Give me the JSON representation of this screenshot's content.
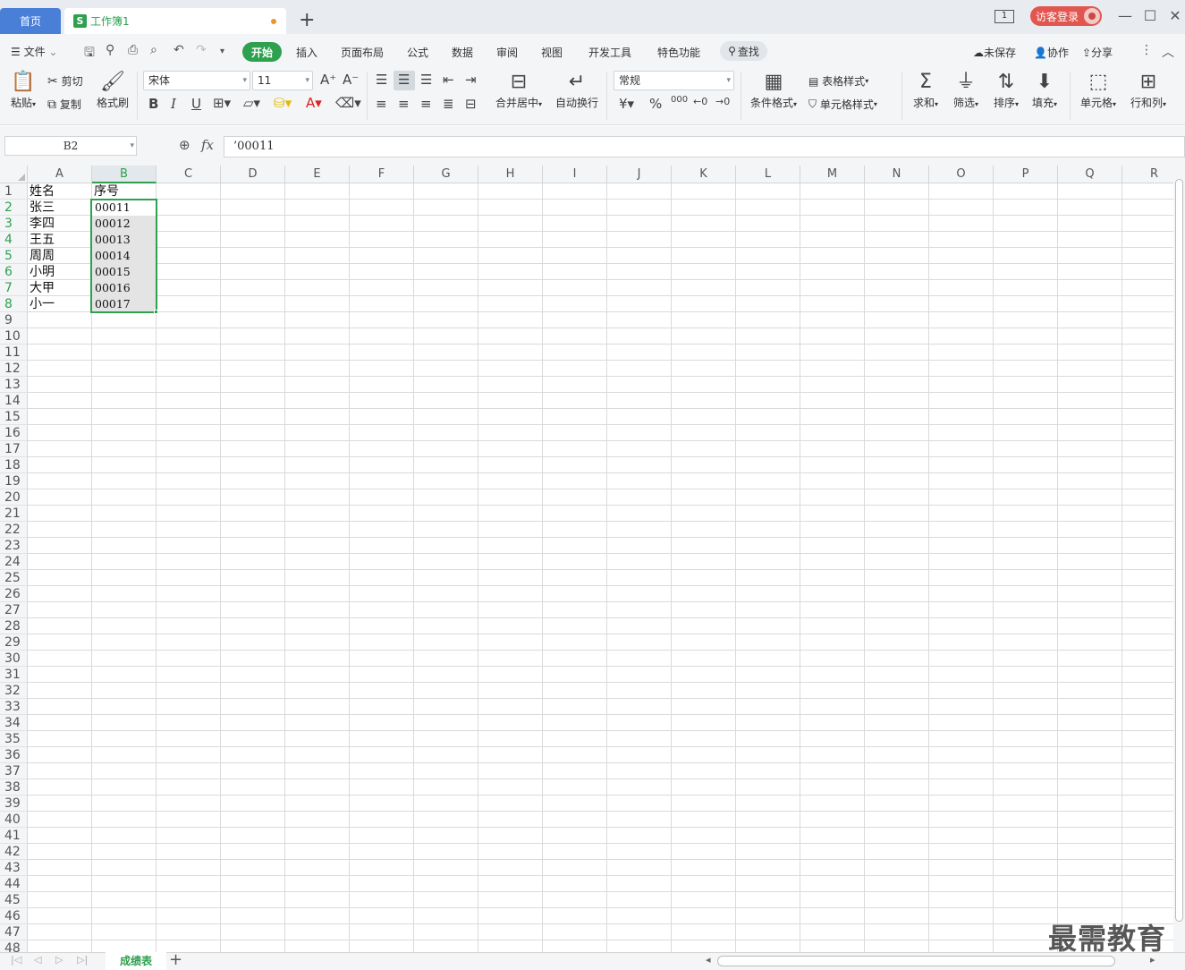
{
  "titlebar": {
    "home_tab": "首页",
    "doc_tab": "工作簿1",
    "doc_logo": "S",
    "page_badge": "1",
    "login": "访客登录",
    "add": "+",
    "minimize": "—",
    "maximize": "☐",
    "close": "✕"
  },
  "menu": {
    "file": "文件",
    "start": "开始",
    "insert": "插入",
    "layout": "页面布局",
    "formula": "公式",
    "data": "数据",
    "review": "审阅",
    "view": "视图",
    "dev": "开发工具",
    "special": "特色功能",
    "search": "查找",
    "unsaved": "未保存",
    "collab": "协作",
    "share": "分享"
  },
  "ribbon": {
    "paste": "粘贴",
    "cut": "剪切",
    "copy": "复制",
    "format_painter": "格式刷",
    "font_name": "宋体",
    "font_size": "11",
    "merge": "合并居中",
    "wrap": "自动换行",
    "number_format": "常规",
    "cond_format": "条件格式",
    "table_style": "表格样式",
    "cell_style": "单元格样式",
    "sum": "求和",
    "filter": "筛选",
    "sort": "排序",
    "fill": "填充",
    "cell": "单元格",
    "rowcol": "行和列",
    "bold": "B",
    "italic": "I",
    "underline": "U",
    "currency": "¥",
    "percent": "%",
    "thousands": "000"
  },
  "formula_bar": {
    "name_box": "B2",
    "fx": "fx",
    "content": "’00011"
  },
  "grid": {
    "columns": [
      "A",
      "B",
      "C",
      "D",
      "E",
      "F",
      "G",
      "H",
      "I",
      "J",
      "K",
      "L",
      "M",
      "N",
      "O",
      "P",
      "Q",
      "R"
    ],
    "rows": [
      "1",
      "2",
      "3",
      "4",
      "5",
      "6",
      "7",
      "8",
      "9",
      "10",
      "11",
      "12",
      "13",
      "14",
      "15",
      "16",
      "17",
      "18",
      "19",
      "20",
      "21",
      "22",
      "23",
      "24",
      "25",
      "26",
      "27",
      "28",
      "29",
      "30",
      "31",
      "32",
      "33",
      "34",
      "35",
      "36",
      "37",
      "38",
      "39",
      "40",
      "41",
      "42",
      "43",
      "44",
      "45",
      "46",
      "47",
      "48"
    ],
    "cells": [
      [
        "姓名",
        "序号"
      ],
      [
        "张三",
        "00011"
      ],
      [
        "李四",
        "00012"
      ],
      [
        "王五",
        "00013"
      ],
      [
        "周周",
        "00014"
      ],
      [
        "小明",
        "00015"
      ],
      [
        "大甲",
        "00016"
      ],
      [
        "小一",
        "00017"
      ]
    ]
  },
  "sheets": {
    "active": "成绩表",
    "add": "+"
  },
  "watermark": "最需教育",
  "colors": {
    "accent": "#2ea04f",
    "home_tab": "#4a7fd8",
    "login": "#e1564f"
  }
}
